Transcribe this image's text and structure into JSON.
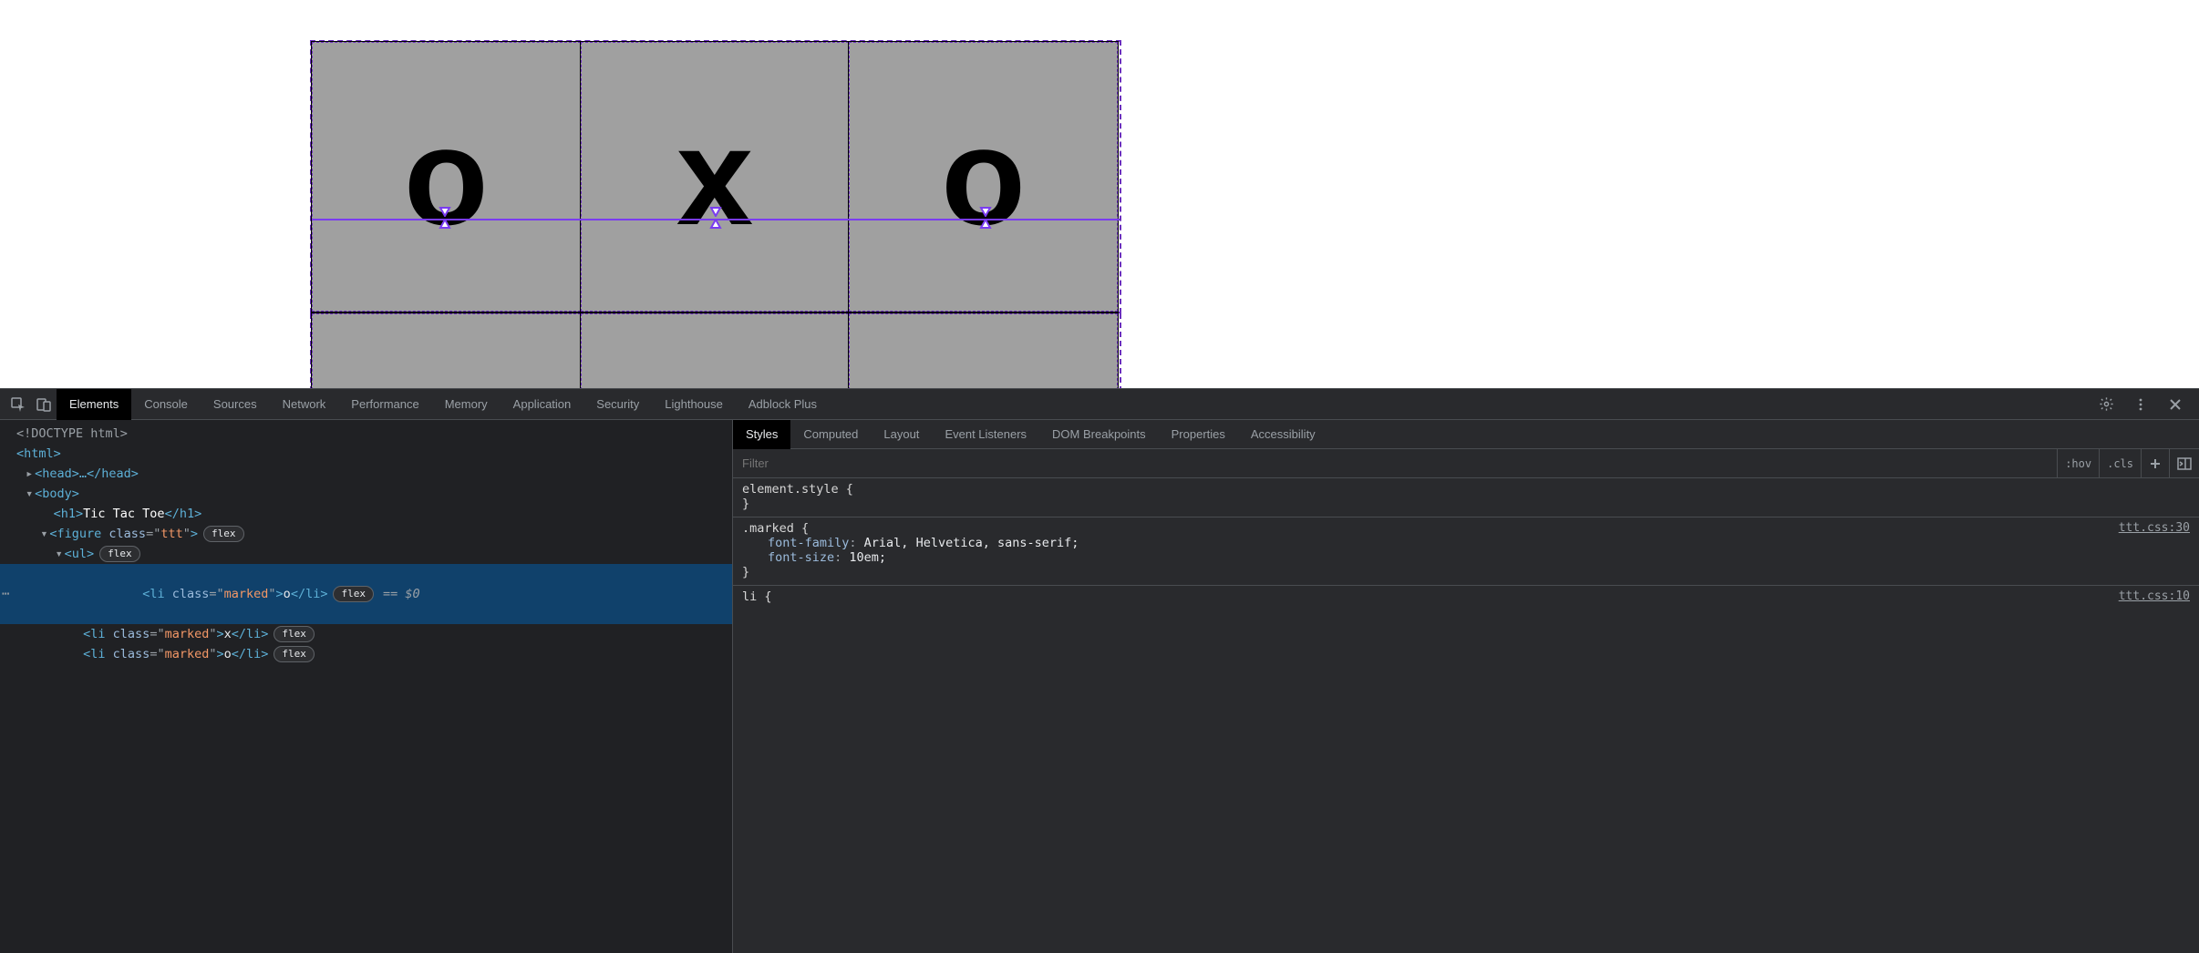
{
  "game": {
    "cells_row1": [
      "o",
      "x",
      "o"
    ],
    "cells_row2": [
      "",
      "",
      ""
    ]
  },
  "devtools": {
    "top_tabs": [
      "Elements",
      "Console",
      "Sources",
      "Network",
      "Performance",
      "Memory",
      "Application",
      "Security",
      "Lighthouse",
      "Adblock Plus"
    ],
    "top_tabs_active": 0,
    "dom": {
      "doctype": "<!DOCTYPE html>",
      "html_open": "<html>",
      "head": "<head>…</head>",
      "body_open": "<body>",
      "h1_open": "<h1>",
      "h1_text": "Tic Tac Toe",
      "h1_close": "</h1>",
      "figure_open_pre": "<figure ",
      "figure_attr_name": "class",
      "figure_attr_val": "ttt",
      "ul_open": "<ul>",
      "li_attr_name": "class",
      "li_attr_val": "marked",
      "li1_text": "o",
      "li2_text": "x",
      "li3_text": "o",
      "flex_badge": "flex",
      "eq0": "== $0"
    },
    "styles": {
      "tabs": [
        "Styles",
        "Computed",
        "Layout",
        "Event Listeners",
        "DOM Breakpoints",
        "Properties",
        "Accessibility"
      ],
      "tabs_active": 0,
      "filter_placeholder": "Filter",
      "hov": ":hov",
      "cls": ".cls",
      "element_style_label": "element.style {",
      "element_style_close": "}",
      "rule1_selector": ".marked {",
      "rule1_source": "ttt.css:30",
      "rule1_p1_prop": "font-family",
      "rule1_p1_val": "Arial, Helvetica, sans-serif;",
      "rule1_p2_prop": "font-size",
      "rule1_p2_val": "10em;",
      "rule1_close": "}",
      "rule2_selector": "li {",
      "rule2_source": "ttt.css:10"
    }
  }
}
